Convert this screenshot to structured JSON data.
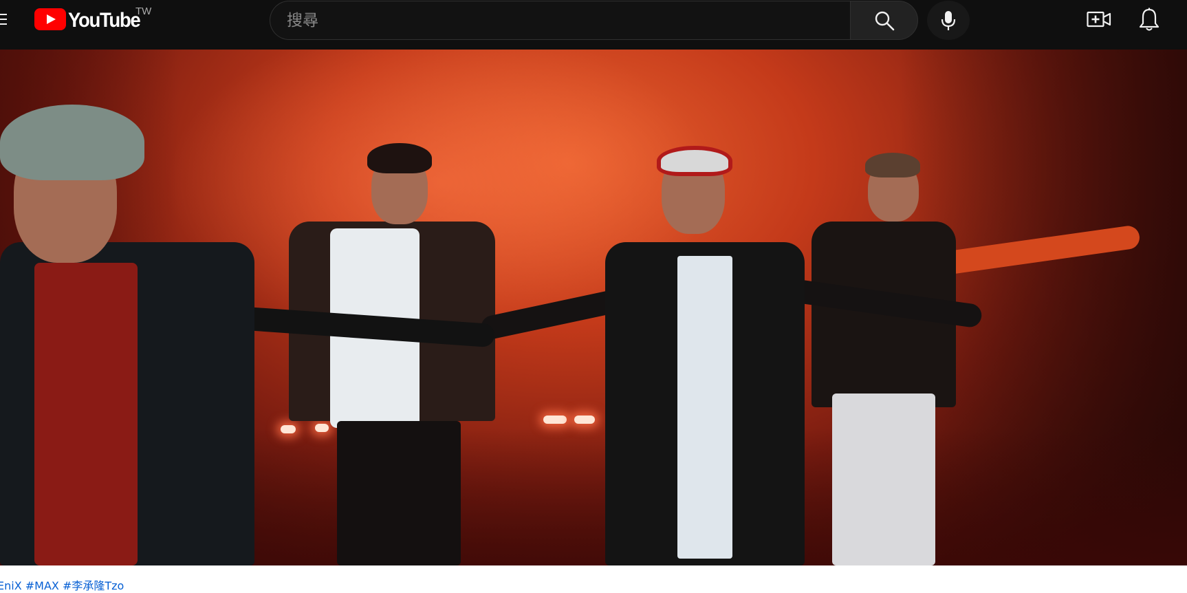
{
  "header": {
    "brand": "YouTube",
    "country_code": "TW",
    "search_placeholder": "搜尋"
  },
  "icons": {
    "menu": "hamburger-menu-icon",
    "logo": "youtube-logo-icon",
    "search": "search-icon",
    "mic": "microphone-icon",
    "create": "video-camera-plus-icon",
    "notifications": "bell-icon"
  },
  "video": {
    "scene": "music video frame, four dancers in front of red smoke"
  },
  "description": {
    "hashtags": "EniX #MAX #李承隆Tzo"
  },
  "colors": {
    "masthead": "#0f0f0f",
    "brand_red": "#ff0000",
    "link": "#065fd4"
  }
}
